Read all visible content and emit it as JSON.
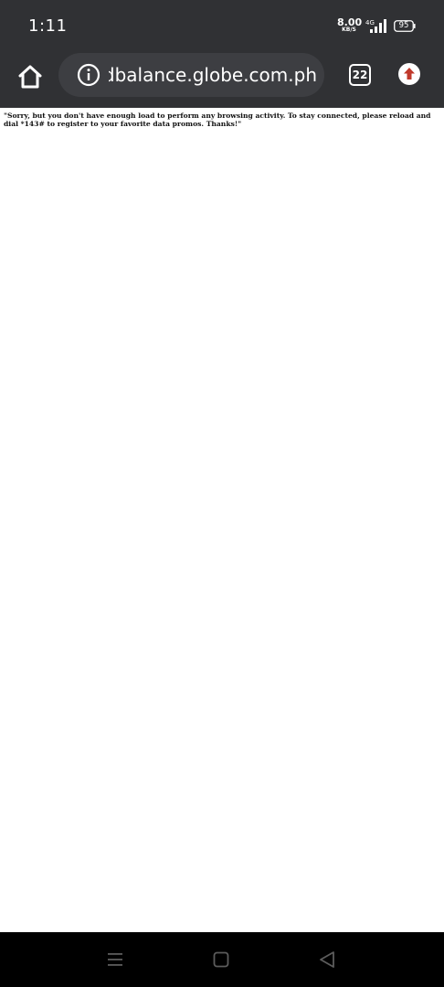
{
  "status_bar": {
    "time": "1:11",
    "net_speed_value": "8.00",
    "net_speed_unit": "KB/S",
    "network_type": "4G",
    "battery_level": "95",
    "icons": [
      "signal-icon",
      "battery-icon"
    ]
  },
  "toolbar": {
    "url": "dbalance.globe.com.ph",
    "tab_count": "22",
    "icons": [
      "home-icon",
      "info-icon",
      "tabs-icon",
      "update-arrow-icon"
    ],
    "update_color": "#c0392b"
  },
  "page": {
    "message": "\"Sorry, but you don't have enough load to perform any browsing activity. To stay connected, please reload and dial *143# to register to your favorite data promos. Thanks!\""
  },
  "nav_bar": {
    "icons": [
      "menu-icon",
      "home-square-icon",
      "back-triangle-icon"
    ]
  },
  "colors": {
    "chrome_bg": "#303134",
    "omnibox_bg": "#3d3e42",
    "nav_bg": "#000000",
    "page_bg": "#ffffff"
  }
}
